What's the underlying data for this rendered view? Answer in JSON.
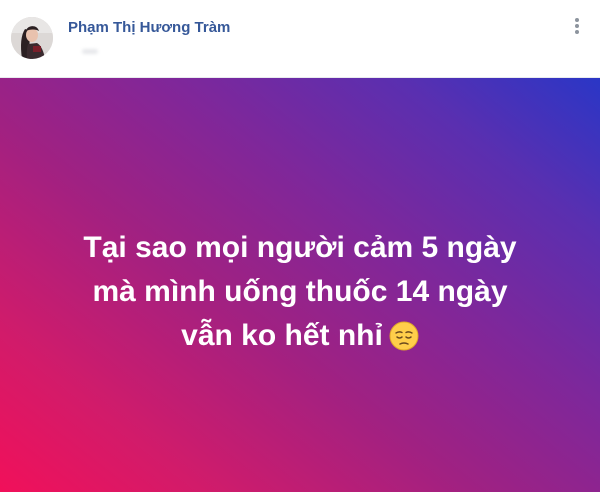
{
  "post": {
    "author_name": "Phạm Thị Hương Tràm",
    "status_lines": [
      "Tại sao mọi người cảm 5 ngày",
      "mà mình uống thuốc 14 ngày",
      "vẫn ko hết nhỉ"
    ],
    "status_emoji": "pensive-face-icon"
  },
  "colors": {
    "author_link": "#365899",
    "gradient_start": "#f1105a",
    "gradient_end": "#2a36c6",
    "status_text": "#ffffff"
  }
}
